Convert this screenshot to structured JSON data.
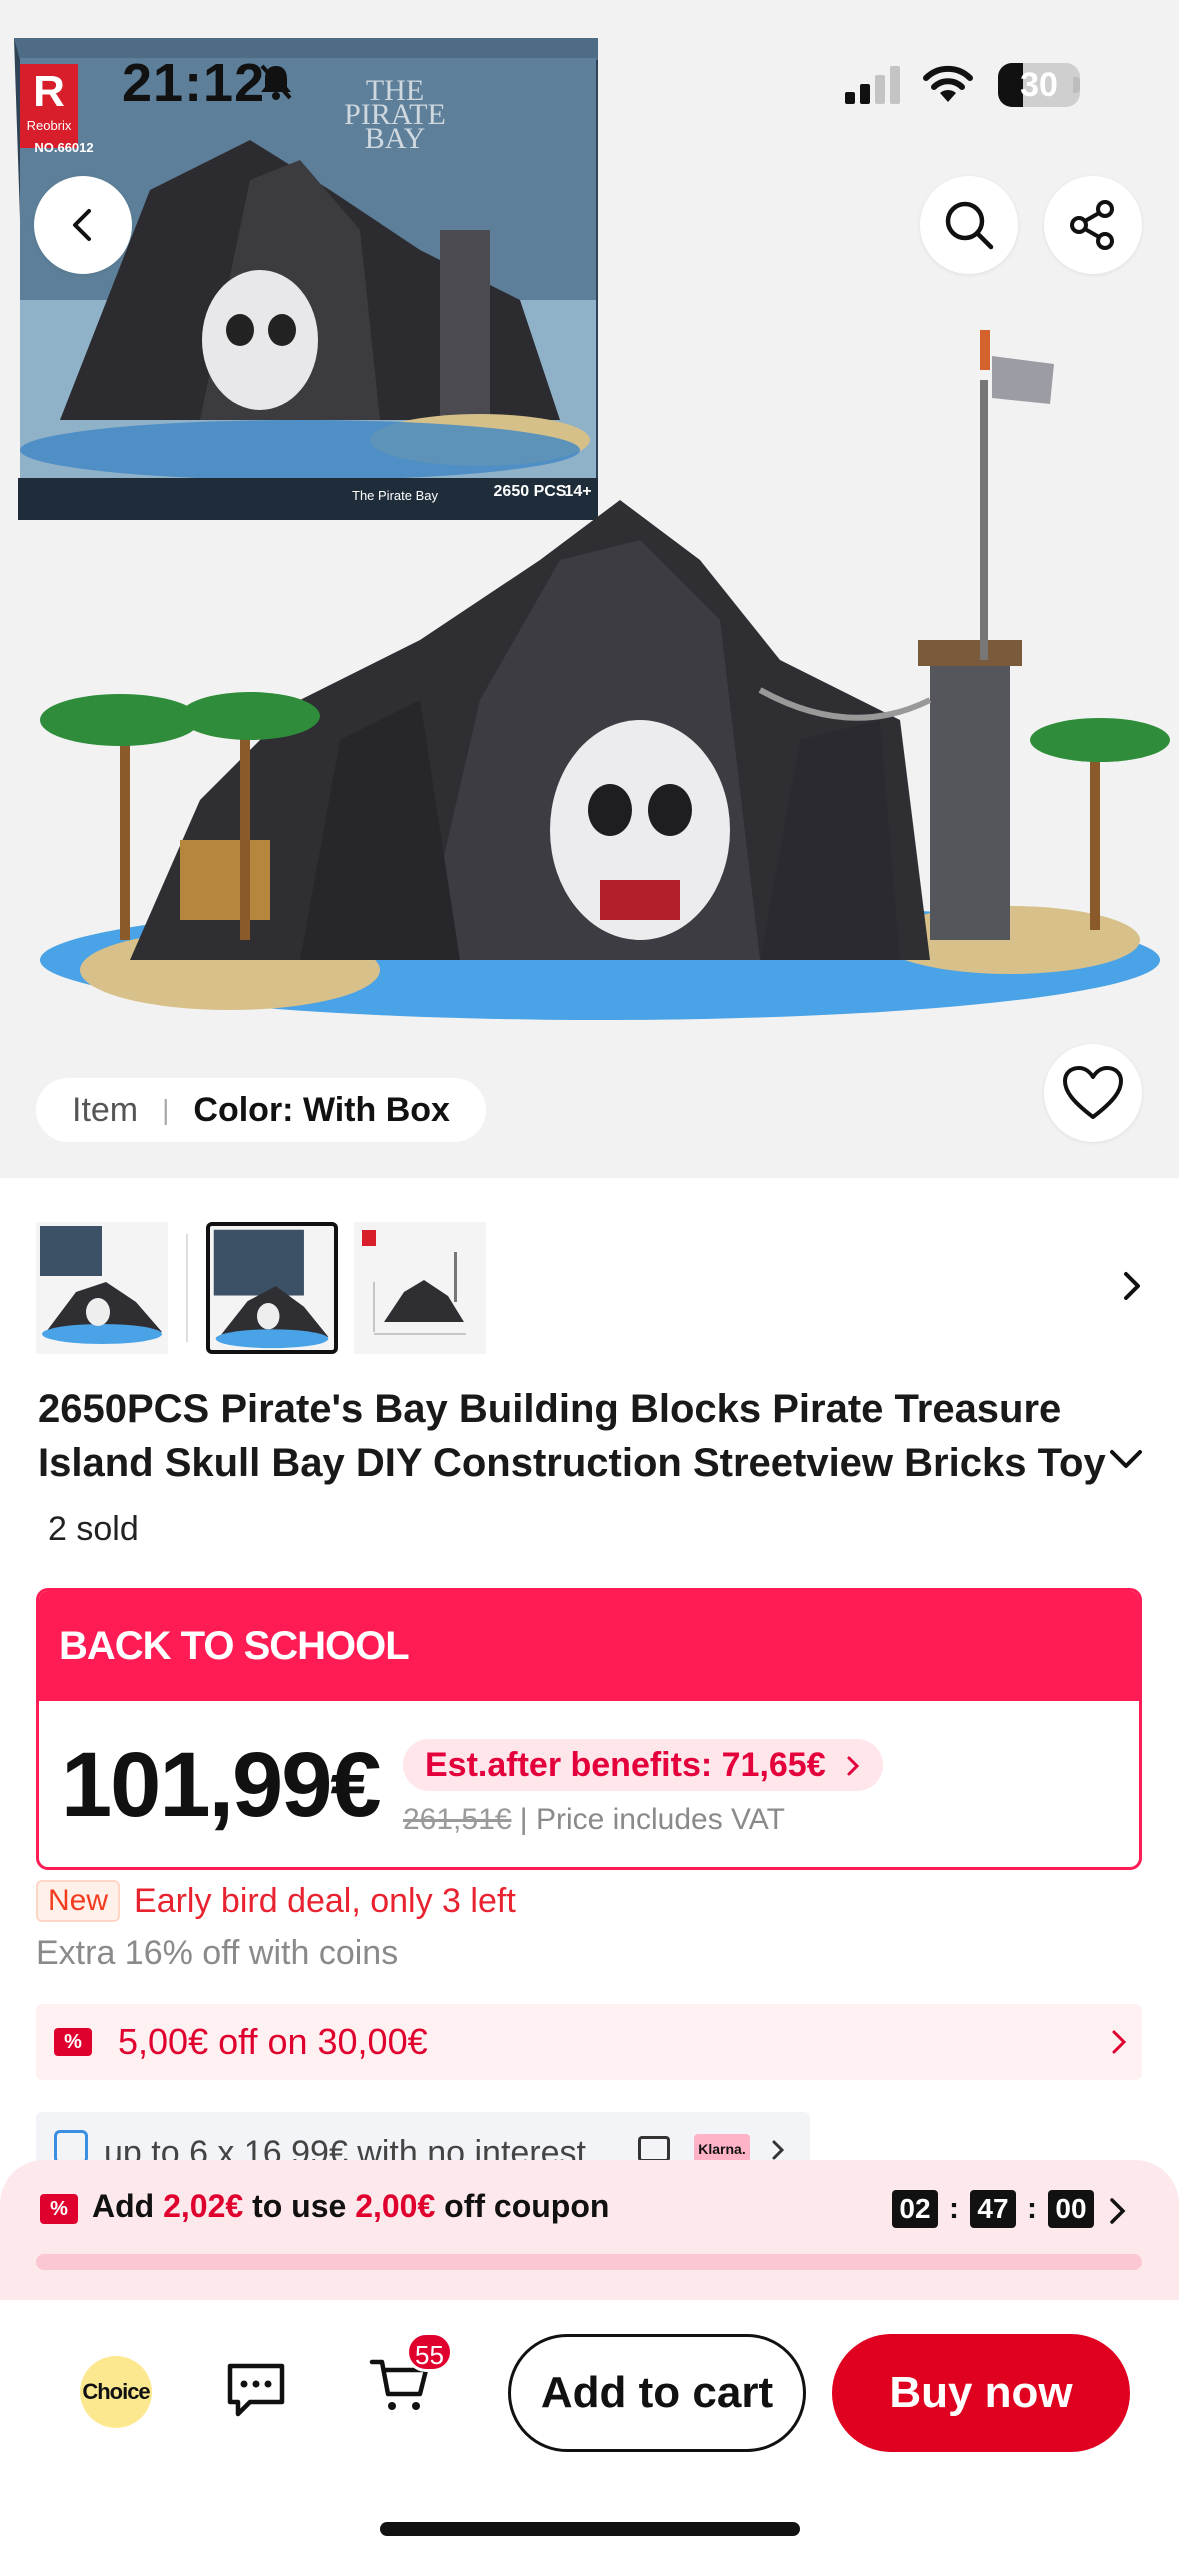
{
  "status_bar": {
    "time": "21:12",
    "battery": "30"
  },
  "box_art": {
    "brand": "Reobrix",
    "number": "NO.66012",
    "title_line1": "THE",
    "title_line2": "PIRATE",
    "title_line3": "BAY",
    "pieces": "2650 PCS",
    "age": "14+",
    "set_name": "The Pirate Bay"
  },
  "variant": {
    "label": "Item",
    "value": "Color: With Box"
  },
  "product": {
    "title_line1": "2650PCS Pirate's Bay Building Blocks Pirate Treasure",
    "title_line2": "Island Skull Bay DIY Construction Streetview Bricks Toy",
    "sold": "2 sold"
  },
  "promo": {
    "banner": "BACK TO SCHOOL",
    "price": "101,99€",
    "est_after_benefits": "Est.after benefits: 71,65€",
    "original_price": "261,51€",
    "vat_note": "Price includes VAT"
  },
  "deal": {
    "badge": "New",
    "text": "Early bird deal, only 3 left",
    "coins": "Extra 16% off with coins"
  },
  "coupon": {
    "icon_text": "%",
    "text": "5,00€ off on 30,00€"
  },
  "installments": {
    "text": "up to 6 x 16,99€ with no interest",
    "klarna": "Klarna."
  },
  "countdown_sheet": {
    "icon_text": "%",
    "prefix": "Add ",
    "amount": "2,02€",
    "middle": " to use ",
    "coupon_amount": "2,00€",
    "suffix": " off coupon",
    "hours": "02",
    "minutes": "47",
    "seconds": "00",
    "progress": 0.0
  },
  "bottom_bar": {
    "choice": "Choice",
    "cart_count": "55",
    "add_to_cart": "Add to cart",
    "buy_now": "Buy now"
  },
  "colors": {
    "accent_red": "#e0001f",
    "promo_pink": "#ff1c55",
    "choice_yellow": "#fce98f"
  }
}
